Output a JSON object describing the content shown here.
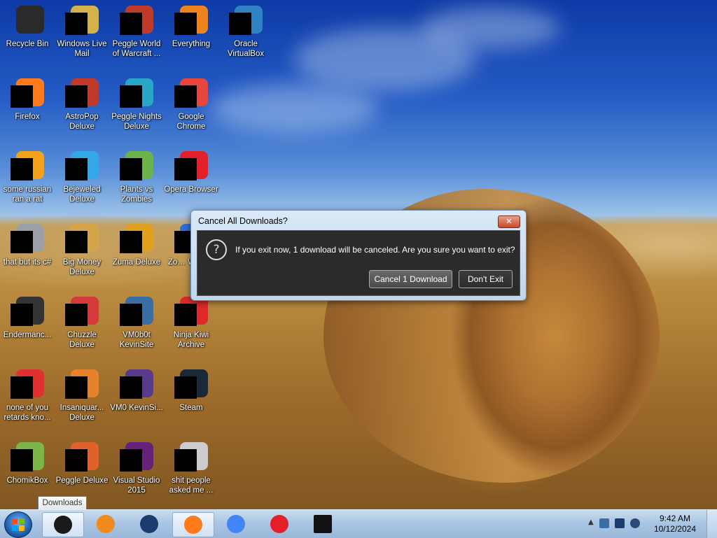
{
  "desktop": {
    "icons": [
      {
        "label": "Recycle Bin",
        "icon": "recycle-bin-icon",
        "color": "#2a2a2a"
      },
      {
        "label": "Windows Live Mail",
        "icon": "mail-icon",
        "color": "#d4b24a"
      },
      {
        "label": "Peggle World of Warcraft ...",
        "icon": "peggle-wow-icon",
        "color": "#c03a2a"
      },
      {
        "label": "Everything",
        "icon": "search-icon",
        "color": "#f0841c"
      },
      {
        "label": "Oracle VirtualBox",
        "icon": "virtualbox-icon",
        "color": "#2f83c4"
      },
      {
        "label": "Firefox",
        "icon": "firefox-icon",
        "color": "#ff7a1a"
      },
      {
        "label": "AstroPop Deluxe",
        "icon": "astropop-icon",
        "color": "#c0392b"
      },
      {
        "label": "Peggle Nights Deluxe",
        "icon": "peggle-nights-icon",
        "color": "#2aa7c7"
      },
      {
        "label": "Google Chrome",
        "icon": "chrome-icon",
        "color": "#e8453c"
      },
      {
        "label": "some russian ran a rat",
        "icon": "app-icon",
        "color": "#f2a31b"
      },
      {
        "label": "Bejeweled Deluxe",
        "icon": "bejeweled-icon",
        "color": "#33a7e8"
      },
      {
        "label": "Plants vs Zombies",
        "icon": "pvz-icon",
        "color": "#6bb34a"
      },
      {
        "label": "Opera Browser",
        "icon": "opera-icon",
        "color": "#e3202a"
      },
      {
        "label": "that but its c#",
        "icon": "copy-icon",
        "color": "#9aa0a6"
      },
      {
        "label": "Big Money Deluxe",
        "icon": "bigmoney-icon",
        "color": "#d6a54a"
      },
      {
        "label": "Zuma Deluxe",
        "icon": "zuma-icon",
        "color": "#e0a020"
      },
      {
        "label": "Zo… Work…",
        "icon": "app-icon",
        "color": "#2f6fd6"
      },
      {
        "label": "Endermanc...",
        "icon": "terminal-icon",
        "color": "#333333"
      },
      {
        "label": "Chuzzle Deluxe",
        "icon": "chuzzle-icon",
        "color": "#d43a3a"
      },
      {
        "label": "VM0b0t KevinSite",
        "icon": "vm-icon",
        "color": "#3a6ea5"
      },
      {
        "label": "Ninja Kiwi Archive",
        "icon": "ninjakiwi-icon",
        "color": "#e02a2a"
      },
      {
        "label": "none of you retards kno...",
        "icon": "app-icon",
        "color": "#e03030"
      },
      {
        "label": "Insaniquar... Deluxe",
        "icon": "insaniquarium-icon",
        "color": "#e8822a"
      },
      {
        "label": "VM0 KevinSi...",
        "icon": "vm-icon",
        "color": "#5a3a8a"
      },
      {
        "label": "Steam",
        "icon": "steam-icon",
        "color": "#1b2838"
      },
      {
        "label": "ChomikBox",
        "icon": "chomikbox-icon",
        "color": "#7ab648"
      },
      {
        "label": "Peggle Deluxe",
        "icon": "peggle-icon",
        "color": "#e0622a"
      },
      {
        "label": "Visual Studio 2015",
        "icon": "visual-studio-icon",
        "color": "#68217a"
      },
      {
        "label": "shit people asked me ...",
        "icon": "document-icon",
        "color": "#cccccc"
      }
    ]
  },
  "dialog": {
    "title": "Cancel All Downloads?",
    "close_label": "✕",
    "message": "If you exit now, 1 download will be canceled. Are you sure you want to exit?",
    "confirm_label": "Cancel 1 Download",
    "cancel_label": "Don't Exit",
    "icon": "question-icon"
  },
  "tooltip": {
    "text": "Downloads"
  },
  "taskbar": {
    "items": [
      {
        "name": "downloads",
        "icon": "downloads-icon",
        "color": "#1a1a1a",
        "active": true
      },
      {
        "name": "media-player",
        "icon": "media-player-icon",
        "color": "#f08a1c",
        "active": false
      },
      {
        "name": "globe",
        "icon": "globe-icon",
        "color": "#1c3b6e",
        "active": false
      },
      {
        "name": "firefox",
        "icon": "firefox-icon",
        "color": "#ff7a1a",
        "active": true
      },
      {
        "name": "chrome",
        "icon": "chrome-icon",
        "color": "#4285f4",
        "active": false
      },
      {
        "name": "opera",
        "icon": "opera-icon",
        "color": "#e3202a",
        "active": false
      },
      {
        "name": "7zip",
        "icon": "7zip-icon",
        "color": "#111111",
        "active": false
      }
    ],
    "clock": {
      "time": "9:42 AM",
      "date": "10/12/2024"
    }
  }
}
